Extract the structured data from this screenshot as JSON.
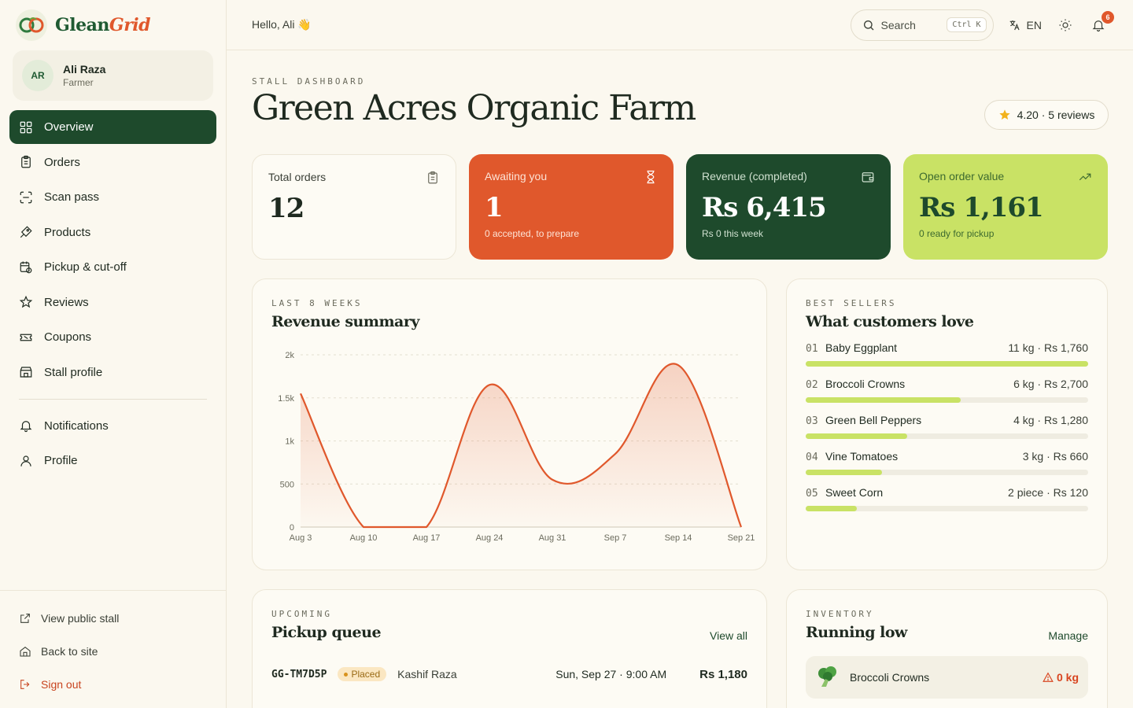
{
  "brand": {
    "name_main": "Glean",
    "name_accent": "Grid"
  },
  "user": {
    "initials": "AR",
    "name": "Ali Raza",
    "role": "Farmer"
  },
  "nav": {
    "items": [
      {
        "label": "Overview",
        "icon": "grid-icon",
        "active": true
      },
      {
        "label": "Orders",
        "icon": "clipboard-icon"
      },
      {
        "label": "Scan pass",
        "icon": "scan-icon"
      },
      {
        "label": "Products",
        "icon": "tag-icon"
      },
      {
        "label": "Pickup & cut-off",
        "icon": "calendar-clock-icon"
      },
      {
        "label": "Reviews",
        "icon": "star-icon"
      },
      {
        "label": "Coupons",
        "icon": "ticket-icon"
      },
      {
        "label": "Stall profile",
        "icon": "store-icon"
      }
    ],
    "secondary": [
      {
        "label": "Notifications",
        "icon": "bell-icon"
      },
      {
        "label": "Profile",
        "icon": "user-icon"
      }
    ],
    "bottom": [
      {
        "label": "View public stall",
        "icon": "external-link-icon"
      },
      {
        "label": "Back to site",
        "icon": "home-icon"
      },
      {
        "label": "Sign out",
        "icon": "logout-icon"
      }
    ]
  },
  "topbar": {
    "greeting": "Hello, Ali 👋",
    "search_label": "Search",
    "search_shortcut": "Ctrl K",
    "language": "EN",
    "notification_count": "6"
  },
  "page": {
    "eyebrow": "Stall dashboard",
    "title": "Green Acres Organic Farm",
    "rating": "4.20 · 5 reviews"
  },
  "stats": [
    {
      "label": "Total orders",
      "value": "12",
      "sub": "",
      "icon": "clipboard-icon"
    },
    {
      "label": "Awaiting you",
      "value": "1",
      "sub": "0 accepted, to prepare",
      "icon": "hourglass-icon"
    },
    {
      "label": "Revenue (completed)",
      "value": "Rs 6,415",
      "sub": "Rs 0 this week",
      "icon": "wallet-icon"
    },
    {
      "label": "Open order value",
      "value": "Rs 1,161",
      "sub": "0 ready for pickup",
      "icon": "trending-up-icon"
    }
  ],
  "revenue": {
    "eyebrow": "Last 8 weeks",
    "title": "Revenue summary"
  },
  "chart_data": {
    "type": "area",
    "x": [
      "Aug 3",
      "Aug 10",
      "Aug 17",
      "Aug 24",
      "Aug 31",
      "Sep 7",
      "Sep 14",
      "Sep 21"
    ],
    "values": [
      1550,
      0,
      0,
      1650,
      550,
      850,
      1880,
      0
    ],
    "yticks": [
      "0",
      "500",
      "1k",
      "1.5k",
      "2k"
    ],
    "ylim": [
      0,
      2000
    ],
    "grid": true,
    "color": "#e0582c"
  },
  "bestsellers": {
    "eyebrow": "Best sellers",
    "title": "What customers love",
    "items": [
      {
        "rank": "01",
        "name": "Baby Eggplant",
        "meta": "11 kg · Rs 1,760",
        "share": 1.0
      },
      {
        "rank": "02",
        "name": "Broccoli Crowns",
        "meta": "6 kg · Rs 2,700",
        "share": 0.55
      },
      {
        "rank": "03",
        "name": "Green Bell Peppers",
        "meta": "4 kg · Rs 1,280",
        "share": 0.36
      },
      {
        "rank": "04",
        "name": "Vine Tomatoes",
        "meta": "3 kg · Rs 660",
        "share": 0.27
      },
      {
        "rank": "05",
        "name": "Sweet Corn",
        "meta": "2 piece · Rs 120",
        "share": 0.18
      }
    ]
  },
  "pickup": {
    "eyebrow": "Upcoming",
    "title": "Pickup queue",
    "link": "View all",
    "orders": [
      {
        "id": "GG-TM7D5P",
        "status": "Placed",
        "customer": "Kashif Raza",
        "when": "Sun, Sep 27 · 9:00 AM",
        "amount": "Rs 1,180"
      }
    ]
  },
  "inventory": {
    "eyebrow": "Inventory",
    "title": "Running low",
    "link": "Manage",
    "items": [
      {
        "name": "Broccoli Crowns",
        "qty": "0 kg"
      }
    ]
  }
}
